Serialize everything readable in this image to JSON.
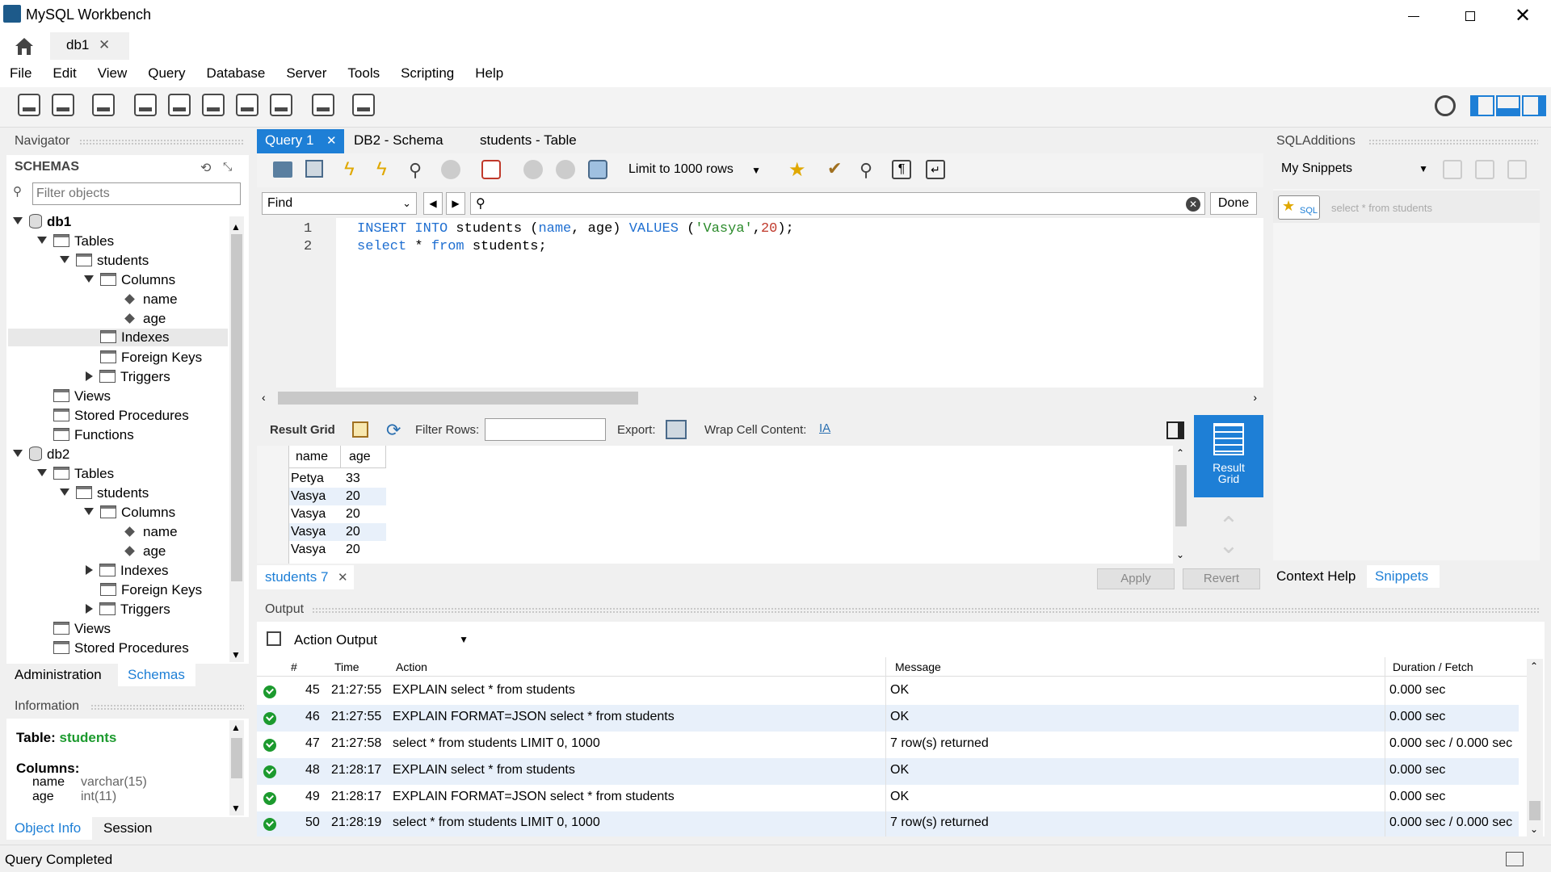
{
  "window": {
    "title": "MySQL Workbench"
  },
  "conn_tab": {
    "label": "db1"
  },
  "menu": [
    "File",
    "Edit",
    "View",
    "Query",
    "Database",
    "Server",
    "Tools",
    "Scripting",
    "Help"
  ],
  "navigator": {
    "title": "Navigator",
    "schemas_label": "SCHEMAS",
    "filter_placeholder": "Filter objects",
    "tree": {
      "db1": "db1",
      "tables": "Tables",
      "students": "students",
      "columns": "Columns",
      "col_name": "name",
      "col_age": "age",
      "indexes": "Indexes",
      "foreign_keys": "Foreign Keys",
      "triggers": "Triggers",
      "views": "Views",
      "stored_procedures": "Stored Procedures",
      "functions": "Functions",
      "db2": "db2"
    },
    "tabs": {
      "administration": "Administration",
      "schemas": "Schemas"
    }
  },
  "information": {
    "title": "Information",
    "table_label": "Table:",
    "table_name": "students",
    "columns_label": "Columns:",
    "columns": [
      {
        "name": "name",
        "type": "varchar(15)"
      },
      {
        "name": "age",
        "type": "int(11)"
      }
    ],
    "tabs": {
      "object_info": "Object Info",
      "session": "Session"
    }
  },
  "editor_tabs": {
    "query1": "Query 1",
    "db2_schema": "DB2 - Schema",
    "students_table": "students - Table"
  },
  "query_toolbar": {
    "limit": "Limit to 1000 rows"
  },
  "find": {
    "mode": "Find",
    "done": "Done"
  },
  "sql": {
    "line1_no": "1",
    "line2_no": "2",
    "line1": {
      "kw1": "INSERT",
      "kw2": "INTO",
      "t1": " students (",
      "c1": "name",
      "t2": ", age) ",
      "kw3": "VALUES",
      "t3": " (",
      "s1": "'Vasya'",
      "t4": ",",
      "n1": "20",
      "t5": ");"
    },
    "line2": {
      "kw1": "select",
      "t1": " * ",
      "kw2": "from",
      "t2": " students;"
    }
  },
  "result_toolbar": {
    "result_grid": "Result Grid",
    "filter_rows": "Filter Rows:",
    "export": "Export:",
    "wrap": "Wrap Cell Content:"
  },
  "result_grid": {
    "headers": [
      "name",
      "age"
    ],
    "rows": [
      [
        "Petya",
        "33"
      ],
      [
        "Vasya",
        "20"
      ],
      [
        "Vasya",
        "20"
      ],
      [
        "Vasya",
        "20"
      ],
      [
        "Vasya",
        "20"
      ]
    ]
  },
  "result_side": {
    "result_grid_label": "Result Grid"
  },
  "result_tab": {
    "label": "students 7"
  },
  "buttons": {
    "apply": "Apply",
    "revert": "Revert"
  },
  "sql_additions": {
    "title": "SQLAdditions",
    "snippets_select": "My Snippets",
    "snippet_text": "select * from students",
    "tabs": {
      "context_help": "Context Help",
      "snippets": "Snippets"
    }
  },
  "output": {
    "title": "Output",
    "mode": "Action Output",
    "headers": {
      "num": "#",
      "time": "Time",
      "action": "Action",
      "message": "Message",
      "duration": "Duration / Fetch"
    },
    "rows": [
      {
        "num": "45",
        "time": "21:27:55",
        "action": "EXPLAIN select * from students",
        "message": "OK",
        "duration": "0.000 sec"
      },
      {
        "num": "46",
        "time": "21:27:55",
        "action": "EXPLAIN FORMAT=JSON select * from students",
        "message": "OK",
        "duration": "0.000 sec"
      },
      {
        "num": "47",
        "time": "21:27:58",
        "action": "select * from students LIMIT 0, 1000",
        "message": "7 row(s) returned",
        "duration": "0.000 sec / 0.000 sec"
      },
      {
        "num": "48",
        "time": "21:28:17",
        "action": "EXPLAIN select * from students",
        "message": "OK",
        "duration": "0.000 sec"
      },
      {
        "num": "49",
        "time": "21:28:17",
        "action": "EXPLAIN FORMAT=JSON select * from students",
        "message": "OK",
        "duration": "0.000 sec"
      },
      {
        "num": "50",
        "time": "21:28:19",
        "action": "select * from students LIMIT 0, 1000",
        "message": "7 row(s) returned",
        "duration": "0.000 sec / 0.000 sec"
      }
    ]
  },
  "status": {
    "text": "Query Completed"
  },
  "colors": {
    "accent": "#1e7fd6",
    "selected_tab": "#1e7fd6",
    "ok": "#1c9a2e",
    "keyword": "#1f6fd1",
    "string": "#2a8a2a",
    "number": "#c0392b"
  }
}
